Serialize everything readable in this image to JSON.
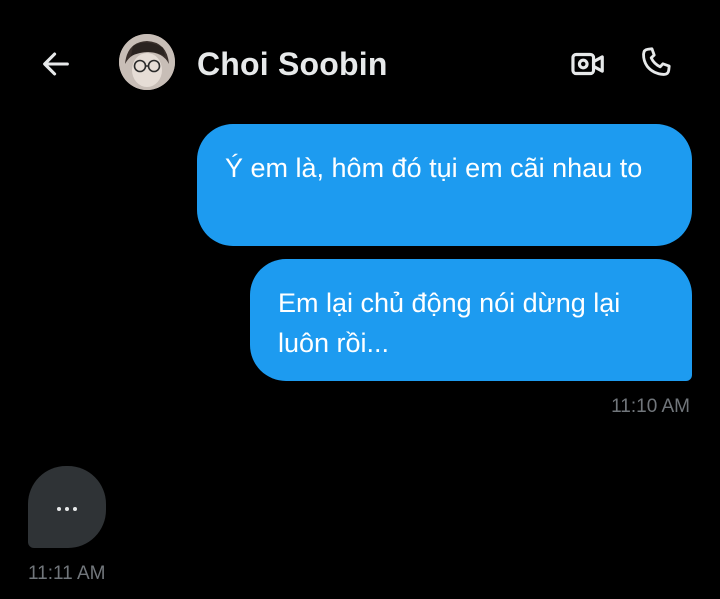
{
  "header": {
    "contact_name": "Choi Soobin",
    "back_icon": "arrow-left-icon",
    "video_icon": "video-camera-icon",
    "call_icon": "phone-icon"
  },
  "messages": [
    {
      "direction": "outgoing",
      "text": "Ý em là, hôm đó tụi em cãi nhau to"
    },
    {
      "direction": "outgoing",
      "text": "Em lại chủ động nói dừng lại luôn rồi..."
    }
  ],
  "outgoing_timestamp": "11:10 AM",
  "incoming": {
    "typing_indicator": true,
    "timestamp": "11:11 AM"
  },
  "colors": {
    "background": "#000000",
    "outgoing_bubble": "#1d9bf0",
    "incoming_bubble": "#2f3336",
    "secondary_text": "#71767b"
  }
}
